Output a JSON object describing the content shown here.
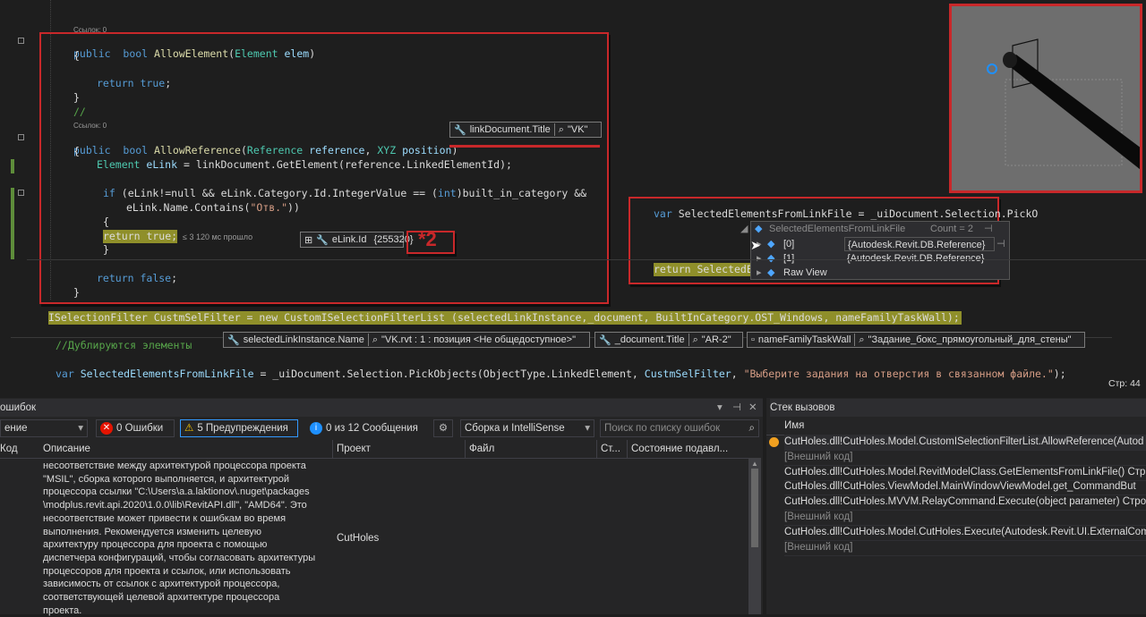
{
  "editor": {
    "refs": {
      "ref1": "Ссылок: 0",
      "ref2": "Ссылок: 0"
    },
    "lines": {
      "l1_kw": "public",
      "l1_kw2": "bool",
      "l1_fn": "AllowElement",
      "l1_ty": "Element",
      "l1_pl": "elem",
      "l2": "{",
      "l3_kw": "return",
      "l3_kw2": "true",
      "l4": "}",
      "l5": "//",
      "l6_kw": "public",
      "l6_kw2": "bool",
      "l6_fn": "AllowReference",
      "l6_ty": "Reference",
      "l6_pl": "reference",
      "l6_ty2": "XYZ",
      "l6_pl2": "position",
      "l7": "{",
      "l8_ty": "Element",
      "l8_pl": "eLink",
      "l8_rest": "= linkDocument.GetElement(reference.LinkedElementId);",
      "l9_a": "if",
      "l9_b": "(eLink!=null && eLink.Category.Id.IntegerValue == (",
      "l9_c": "int",
      "l9_d": ")built_in_category &&",
      "l10_a": "eLink.Name.Contains(",
      "l10_s": "\"Отв.\"",
      "l10_b": "))",
      "l11": "{",
      "l12": "return true;",
      "l12_hint": "≤ 3 120 мс прошло",
      "l13": "}",
      "l14_kw": "return",
      "l14_kw2": "false",
      "l15": "}",
      "isel_line": "ISelectionFilter CustmSelFilter = new CustomISelectionFilterList (selectedLinkInstance,_document, BuiltInCategory.OST_Windows, nameFamilyTaskWall);",
      "comment": "//Дублируются элементы",
      "pick_kw": "var",
      "pick_var": "SelectedElementsFromLinkFile",
      "pick_rest": " = _uiDocument.Selection.PickObjects(ObjectType.LinkedElement, ",
      "pick_pl": "CustmSelFilter",
      "pick_str": "\"Выберите задания на отверстия в связанном файле.\"",
      "pick_end": ");"
    },
    "tips": {
      "linkdoc_name": "linkDocument.Title",
      "linkdoc_val": "\"VK\"",
      "elink_name": "eLink.Id",
      "elink_val": "{255320}",
      "x2_label": "*2",
      "sel_name": "selectedLinkInstance.Name",
      "sel_val": "\"VK.rvt : 1 : позиция <Не общедоступное>\"",
      "doc_name": "_document.Title",
      "doc_val": "\"AR-2\"",
      "fam_name": "nameFamilyTaskWall",
      "fam_val": "\"Задание_бокс_прямоугольный_для_стены\""
    },
    "popup": {
      "line1_kw": "var",
      "line1_rest": "SelectedElementsFromLinkFile = _uiDocument.Selection.PickO",
      "line2": "return SelectedE",
      "header_name": "SelectedElementsFromLinkFile",
      "header_count": "Count = 2",
      "items": [
        {
          "index": "[0]",
          "value": "{Autodesk.Revit.DB.Reference}"
        },
        {
          "index": "[1]",
          "value": "{Autodesk.Revit.DB.Reference}"
        },
        {
          "index": "Raw View",
          "value": ""
        }
      ]
    },
    "status_line": "Стр: 44"
  },
  "errors_panel": {
    "title": "ошибок",
    "scope_select": "ение",
    "errors_btn": "0 Ошибки",
    "warnings_btn": "5 Предупреждения",
    "messages_btn": "0 из 12 Сообщения",
    "build_select": "Сборка и IntelliSense",
    "search_placeholder": "Поиск по списку ошибок",
    "columns": {
      "code": "Код",
      "desc": "Описание",
      "project": "Проект",
      "file": "Файл",
      "line": "Ст...",
      "state": "Состояние подавл..."
    },
    "row": {
      "desc_lines": [
        "несоответствие между архитектурой процессора проекта",
        "\"MSIL\", сборка которого выполняется, и архитектурой",
        "процессора ссылки \"C:\\Users\\a.a.laktionov\\.nuget\\packages",
        "\\modplus.revit.api.2020\\1.0.0\\lib\\RevitAPI.dll\", \"AMD64\". Это",
        "несоответствие может привести к ошибкам во время",
        "выполнения. Рекомендуется изменить целевую",
        "архитектуру процессора для проекта с помощью",
        "диспетчера конфигураций, чтобы согласовать архитектуры",
        "процессоров для проекта и ссылок, или использовать",
        "зависимость от ссылок с архитектурой процессора,",
        "соответствующей целевой архитектуре процессора",
        "проекта."
      ],
      "project": "CutHoles"
    }
  },
  "callstack": {
    "title": "Стек вызовов",
    "col_name": "Имя",
    "rows": [
      {
        "text": "CutHoles.dll!CutHoles.Model.CustomISelectionFilterList.AllowReference(Autod",
        "external": false,
        "current": true
      },
      {
        "text": "[Внешний код]",
        "external": true,
        "current": false
      },
      {
        "text": "CutHoles.dll!CutHoles.Model.RevitModelClass.GetElementsFromLinkFile() Стр",
        "external": false,
        "current": false
      },
      {
        "text": "CutHoles.dll!CutHoles.ViewModel.MainWindowViewModel.get_CommandBut",
        "external": false,
        "current": false
      },
      {
        "text": "CutHoles.dll!CutHoles.MVVM.RelayCommand.Execute(object parameter) Стро",
        "external": false,
        "current": false
      },
      {
        "text": "[Внешний код]",
        "external": true,
        "current": false
      },
      {
        "text": "CutHoles.dll!CutHoles.Model.CutHoles.Execute(Autodesk.Revit.UI.ExternalCom",
        "external": false,
        "current": false
      },
      {
        "text": "[Внешний код]",
        "external": true,
        "current": false
      }
    ]
  },
  "colors": {
    "accent_red": "#c8282a",
    "highlight": "#8f8f2a",
    "background": "#1e1e1e"
  }
}
